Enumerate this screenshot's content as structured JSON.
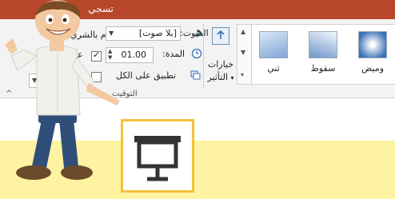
{
  "titlebar": {
    "title_fragment": "تسجي"
  },
  "ribbon": {
    "advance_label": "تقدم بالشري",
    "on_click_label": "عند",
    "sound_label": "الصوت:",
    "sound_value": "[بلا صوت]",
    "duration_label": "المدة:",
    "duration_value": "01.00",
    "apply_all_label": "تطبيق على الكل",
    "effect_options_line1": "خيارات",
    "effect_options_line2": "التأثير",
    "group_label": "التوقيت",
    "transitions": [
      {
        "label": "وميض",
        "color": "#3a6fb5"
      },
      {
        "label": "سقوط",
        "color": "#6d95c9"
      },
      {
        "label": "ثني",
        "color": "#7fa6d6"
      }
    ]
  },
  "canvas": {
    "stripe_color": "#fef3a0",
    "tile_border_color": "#f2c23a",
    "icon": "presentation-screen-icon"
  }
}
